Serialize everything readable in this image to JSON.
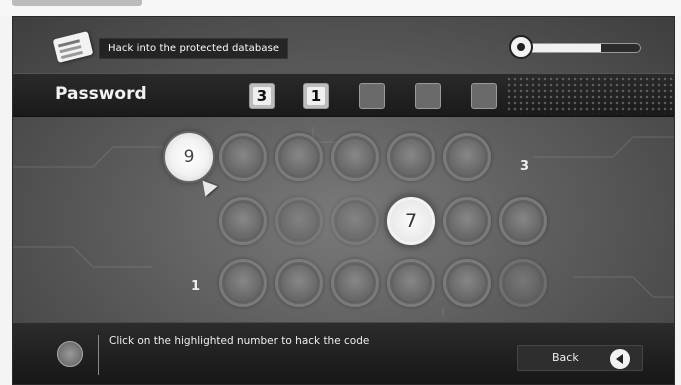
{
  "mission": {
    "text": "Hack into the protected database",
    "icon": "id-card-icon"
  },
  "progress": {
    "value": 0.68
  },
  "password": {
    "label": "Password",
    "slots": [
      "3",
      "1",
      "",
      "",
      ""
    ]
  },
  "grid": {
    "rows": [
      {
        "hint_right": "3",
        "nodes": [
          {
            "value": "9",
            "state": "active"
          },
          {
            "value": "",
            "state": "normal"
          },
          {
            "value": "",
            "state": "normal"
          },
          {
            "value": "",
            "state": "normal"
          },
          {
            "value": "",
            "state": "normal"
          },
          {
            "value": "",
            "state": "normal"
          }
        ]
      },
      {
        "nodes": [
          {
            "value": "",
            "state": "normal"
          },
          {
            "value": "",
            "state": "dim"
          },
          {
            "value": "",
            "state": "dim"
          },
          {
            "value": "7",
            "state": "selected"
          },
          {
            "value": "",
            "state": "normal"
          },
          {
            "value": "",
            "state": "normal"
          }
        ]
      },
      {
        "hint_left": "1",
        "nodes": [
          {
            "value": "",
            "state": "normal"
          },
          {
            "value": "",
            "state": "normal"
          },
          {
            "value": "",
            "state": "normal"
          },
          {
            "value": "",
            "state": "normal"
          },
          {
            "value": "",
            "state": "normal"
          },
          {
            "value": "",
            "state": "dim"
          }
        ]
      }
    ]
  },
  "footer": {
    "instruction": "Click on the highlighted number to hack the code",
    "back_label": "Back",
    "radar_icon": "radar-icon",
    "back_icon": "back-arrow-icon"
  }
}
